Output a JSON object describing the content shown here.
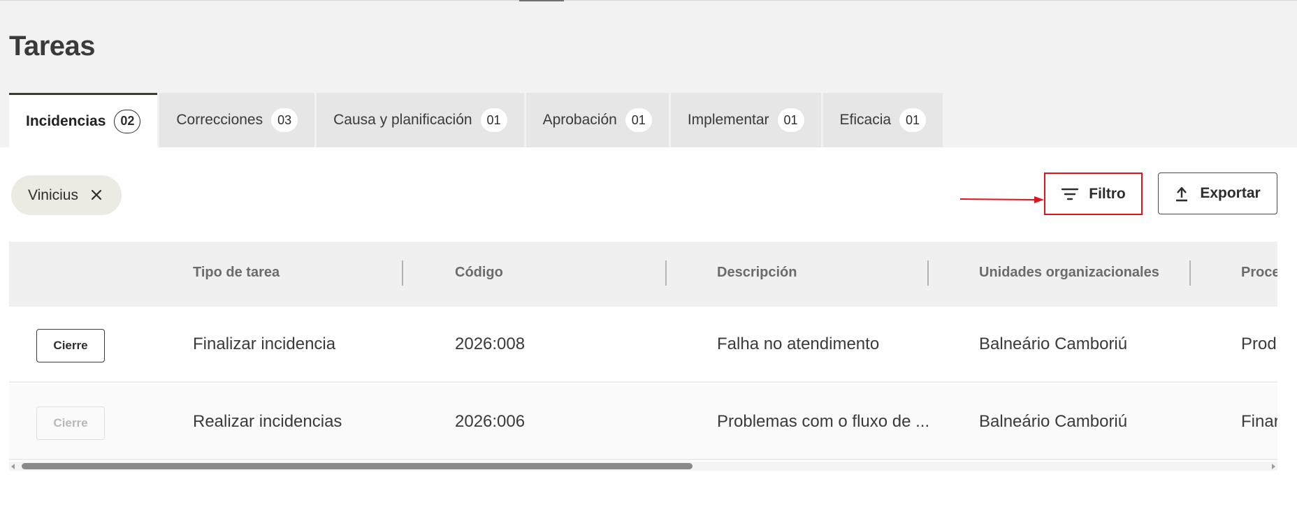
{
  "page": {
    "title": "Tareas"
  },
  "tabs": [
    {
      "label": "Incidencias",
      "count": "02",
      "active": true
    },
    {
      "label": "Correcciones",
      "count": "03",
      "active": false
    },
    {
      "label": "Causa y planificación",
      "count": "01",
      "active": false
    },
    {
      "label": "Aprobación",
      "count": "01",
      "active": false
    },
    {
      "label": "Implementar",
      "count": "01",
      "active": false
    },
    {
      "label": "Eficacia",
      "count": "01",
      "active": false
    }
  ],
  "filter_chip": {
    "label": "Vinicius",
    "close_icon": "close-icon"
  },
  "toolbar": {
    "filter_label": "Filtro",
    "filter_icon": "filter-icon",
    "export_label": "Exportar",
    "export_icon": "upload-icon"
  },
  "table": {
    "columns": [
      "Tipo de tarea",
      "Código",
      "Descripción",
      "Unidades organizacionales",
      "Proce"
    ],
    "rows": [
      {
        "action": "Cierre",
        "action_enabled": true,
        "tipo": "Finalizar incidencia",
        "codigo": "2026:008",
        "descripcion": "Falha no atendimento",
        "unidades": "Balneário Camboriú",
        "proceso": "Produ"
      },
      {
        "action": "Cierre",
        "action_enabled": false,
        "tipo": "Realizar incidencias",
        "codigo": "2026:006",
        "descripcion": "Problemas com o fluxo de ...",
        "unidades": "Balneário Camboriú",
        "proceso": "Finar"
      }
    ]
  },
  "colors": {
    "highlight": "#e0141c",
    "active_tab_border": "#3b3b2e",
    "chip_bg": "#ebebe3"
  }
}
